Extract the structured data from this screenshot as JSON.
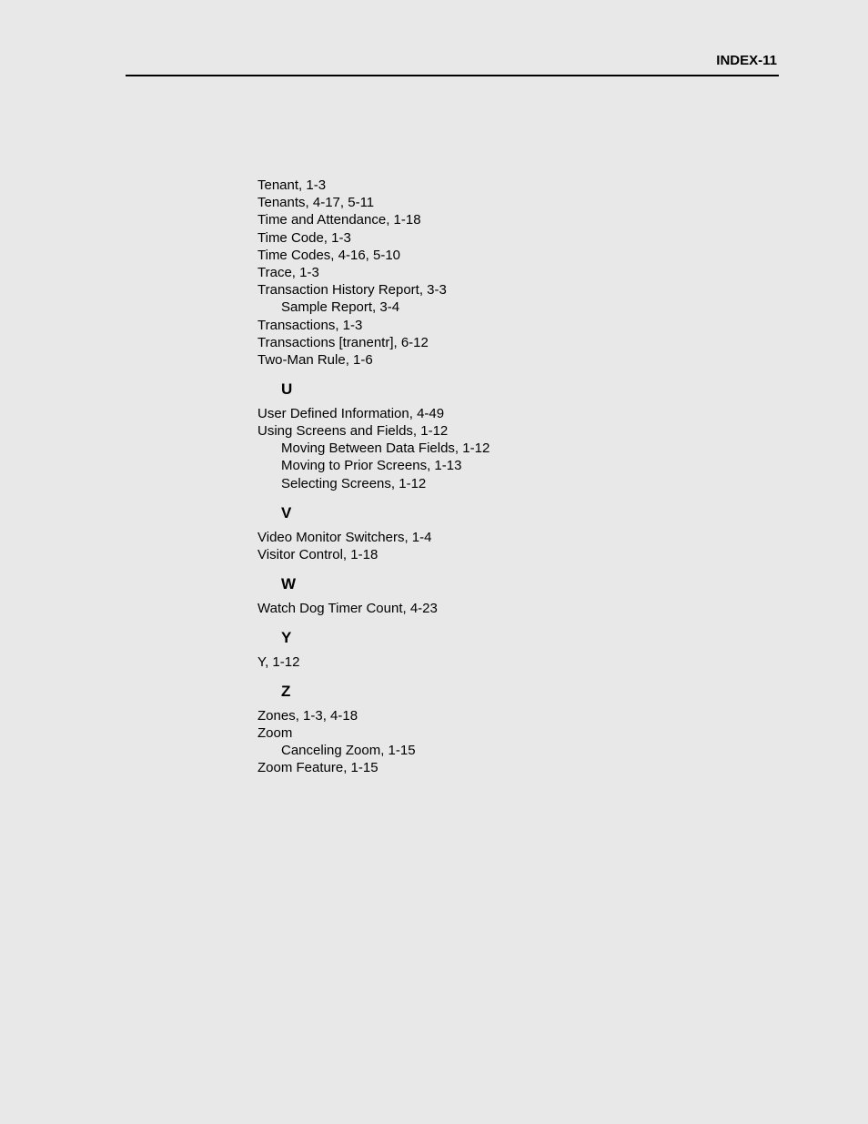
{
  "header": {
    "pageLabel": "INDEX-11"
  },
  "index": {
    "preEntries": [
      "Tenant,  1-3",
      "Tenants,  4-17,  5-11",
      "Time and Attendance,  1-18",
      "Time Code,  1-3",
      "Time Codes,  4-16,  5-10",
      "Trace,  1-3",
      "Transaction History Report,  3-3"
    ],
    "preSubEntries": [
      "Sample Report,  3-4"
    ],
    "preEntries2": [
      "Transactions,  1-3",
      "Transactions [tranentr],  6-12",
      "Two-Man Rule,  1-6"
    ],
    "sectionU": {
      "letter": "U",
      "entries": [
        "User Defined Information,  4-49",
        "Using Screens and Fields,  1-12"
      ],
      "subEntries": [
        "Moving Between Data Fields,  1-12",
        "Moving to Prior Screens,  1-13",
        "Selecting Screens,  1-12"
      ]
    },
    "sectionV": {
      "letter": "V",
      "entries": [
        "Video Monitor Switchers,  1-4",
        "Visitor Control,  1-18"
      ]
    },
    "sectionW": {
      "letter": "W",
      "entries": [
        "Watch Dog Timer Count,  4-23"
      ]
    },
    "sectionY": {
      "letter": "Y",
      "entries": [
        "Y,  1-12"
      ]
    },
    "sectionZ": {
      "letter": "Z",
      "entries1": [
        "Zones,  1-3,  4-18",
        "Zoom"
      ],
      "subEntries": [
        "Canceling Zoom,  1-15"
      ],
      "entries2": [
        "Zoom Feature,  1-15"
      ]
    }
  }
}
